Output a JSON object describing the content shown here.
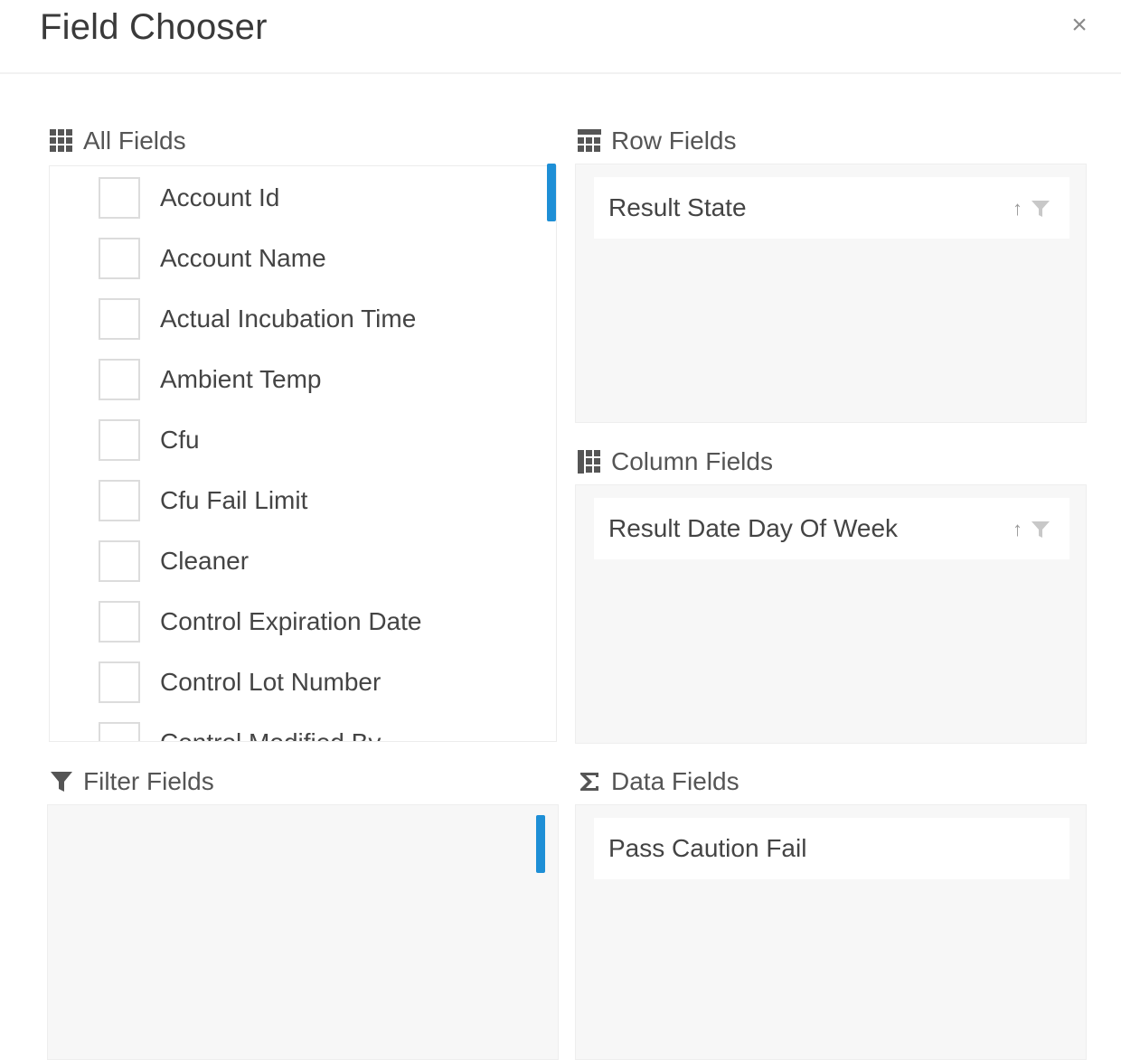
{
  "dialog": {
    "title": "Field Chooser",
    "close_glyph": "×"
  },
  "all_fields": {
    "header": "All Fields",
    "icon": "grid-icon",
    "items": [
      {
        "label": "Account Id",
        "checked": false
      },
      {
        "label": "Account Name",
        "checked": false
      },
      {
        "label": "Actual Incubation Time",
        "checked": false
      },
      {
        "label": "Ambient Temp",
        "checked": false
      },
      {
        "label": "Cfu",
        "checked": false
      },
      {
        "label": "Cfu Fail Limit",
        "checked": false
      },
      {
        "label": "Cleaner",
        "checked": false
      },
      {
        "label": "Control Expiration Date",
        "checked": false
      },
      {
        "label": "Control Lot Number",
        "checked": false
      },
      {
        "label": "Control Modified By",
        "checked": false
      }
    ]
  },
  "row_fields": {
    "header": "Row Fields",
    "icon": "rows-icon",
    "items": [
      {
        "label": "Result State",
        "sort_glyph": "↑"
      }
    ]
  },
  "column_fields": {
    "header": "Column Fields",
    "icon": "columns-icon",
    "items": [
      {
        "label": "Result Date Day Of Week",
        "sort_glyph": "↑"
      }
    ]
  },
  "filter_fields": {
    "header": "Filter Fields",
    "icon": "filter-icon",
    "items": []
  },
  "data_fields": {
    "header": "Data Fields",
    "icon": "sigma-icon",
    "items": [
      {
        "label": "Pass Caution Fail"
      }
    ]
  },
  "colors": {
    "accent": "#1e8fd6",
    "zone_bg": "#f7f7f7",
    "icon": "#555555"
  }
}
